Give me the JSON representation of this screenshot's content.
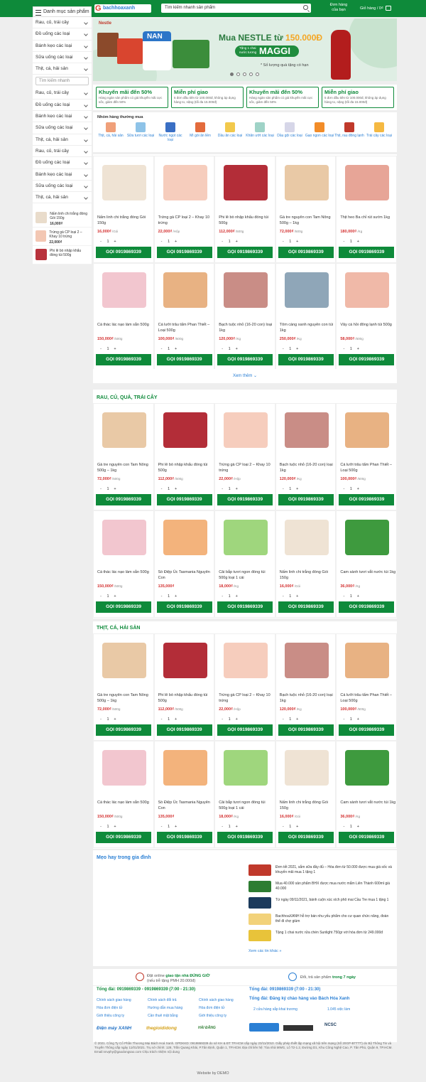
{
  "header": {
    "logo_text": "bachhoaxanh",
    "search_placeholder": "Tìm kiếm nhanh sản phẩm",
    "orders_label": "Đơn hàng của bạn",
    "cart_label": "Giỏ hàng / 0₫"
  },
  "sidebar": {
    "title": "Danh mục sản phẩm",
    "categories_a": [
      "Rau, củ, trái cây",
      "Đồ uống các loại",
      "Bánh kẹo các loại",
      "Sữa uống các loại",
      "Thịt, cá, hải sản"
    ],
    "search_placeholder": "Tìm kiếm nhanh",
    "categories_b": [
      "Rau, củ, trái cây",
      "Đồ uống các loại",
      "Bánh kẹo các loại",
      "Sữa uống các loại",
      "Thịt, cá, hải sản",
      "Rau, củ, trái cây",
      "Đồ uống các loại",
      "Bánh kẹo các loại",
      "Sữa uống các loại",
      "Thịt, cá, hải sản"
    ],
    "mini_products": [
      {
        "name": "Nấm linh chi trắng đóng Gói 150g",
        "price": "16,000₫",
        "color": "#e9dccb"
      },
      {
        "name": "Trứng gà CP loại 2 – Khay 10 trứng",
        "price": "22,000₫",
        "color": "#f3c7b3"
      },
      {
        "name": "Phi lê bò nhập khẩu đóng túi 500g",
        "price": "",
        "color": "#b8323c"
      }
    ]
  },
  "banner": {
    "brand": "Nestle",
    "title_prefix": "Mua NESTLE từ ",
    "title_amount": "150.000Đ",
    "badge_small": "Tặng 1 chai nước tương",
    "badge": "MAGGI",
    "note": "* Số lượng quà tặng có hạn",
    "tin_label": "NAN"
  },
  "promos": [
    {
      "title": "Khuyến mãi đến 50%",
      "desc": "Hàng ngàn sản phẩm có giá khuyến mãi cực sốc, giảm đến 50%"
    },
    {
      "title": "Miễn phí giao",
      "desc": "5 đơn đầu tiên từ 100.000đ, không áp dụng hàng to, nặng (tối đa 15.000đ)"
    },
    {
      "title": "Khuyến mãi đến 50%",
      "desc": "Hàng ngàn sản phẩm có giá khuyến mãi cực sốc, giảm đến 50%"
    },
    {
      "title": "Miễn phí giao",
      "desc": "5 đơn đầu tiên từ 100.000đ, không áp dụng hàng to, nặng (tối đa 15.000đ)"
    }
  ],
  "groups": {
    "title": "Nhóm hàng thường mua",
    "items": [
      {
        "label": "Thịt, cá, hải sản",
        "color": "#f0a07a"
      },
      {
        "label": "Sữa tươi các loại",
        "color": "#8ec3e8"
      },
      {
        "label": "Nước ngọt các loại",
        "color": "#3a6fc4"
      },
      {
        "label": "Mì gói ăn liền",
        "color": "#e36b3c"
      },
      {
        "label": "Dầu ăn các loại",
        "color": "#f2c94c"
      },
      {
        "label": "Khăn ướt các loại",
        "color": "#9fd3c7"
      },
      {
        "label": "Dầu gội các loại",
        "color": "#d6d6e8"
      },
      {
        "label": "Gạo ngon các loại",
        "color": "#f28c28"
      },
      {
        "label": "Thịt, rau đông lạnh",
        "color": "#c0392b"
      },
      {
        "label": "Trái cây các loại",
        "color": "#f5b942"
      }
    ]
  },
  "products_featured": [
    {
      "name": "Nấm linh chi trắng đóng Gói 150g",
      "price": "16,000₫",
      "unit": " /Gói",
      "color": "#efe3d4"
    },
    {
      "name": "Trứng gà CP loại 2 – Khay 10 trứng",
      "price": "22,000₫",
      "unit": " /Hộp",
      "color": "#f6cdbd"
    },
    {
      "name": "Phi lê bò nhập khẩu đóng túi 500g",
      "price": "112,000₫",
      "unit": " /500g",
      "color": "#b32d38"
    },
    {
      "name": "Gà tre nguyên con Tam Nông 500g – 1kg",
      "price": "72,000₫",
      "unit": " /500g",
      "color": "#e9c9a6"
    },
    {
      "name": "Thịt heo Ba chỉ rút sườn 1kg",
      "price": "180,000₫",
      "unit": " /Kg",
      "color": "#e7a597"
    },
    {
      "name": "Cá thác lác nạo làm sẵn 500g",
      "price": "150,000₫",
      "unit": " /500g",
      "color": "#f2c6cf"
    },
    {
      "name": "Cá lưỡi trâu tẩm Phan Thiết – Loại 500g",
      "price": "100,000₫",
      "unit": " /500g",
      "color": "#e8b283"
    },
    {
      "name": "Bạch tuộc nhỏ (16-20 con) loại 1kg",
      "price": "120,000₫",
      "unit": " /Kg",
      "color": "#c98d86"
    },
    {
      "name": "Tôm càng xanh nguyên con túi 1kg",
      "price": "250,000₫",
      "unit": " /Kg",
      "color": "#8fa6b8"
    },
    {
      "name": "Vây cá hồi đông lạnh túi 500g",
      "price": "58,000₫",
      "unit": " /500g",
      "color": "#f0b9a8"
    }
  ],
  "more_label": "Xem thêm ⌄",
  "section1_title": "RAU, CỦ, QUẢ, TRÁI CÂY",
  "section2_title": "THỊT, CÁ, HẢI SẢN",
  "products_section": [
    {
      "name": "Gà tre nguyên con Tam Nông 500g – 1kg",
      "price": "72,000₫",
      "unit": " /500g",
      "color": "#e9c9a6"
    },
    {
      "name": "Phi lê bò nhập khẩu đóng túi 500g",
      "price": "112,000₫",
      "unit": " /500g",
      "color": "#b32d38"
    },
    {
      "name": "Trứng gà CP loại 2 – Khay 10 trứng",
      "price": "22,000₫",
      "unit": " /Hộp",
      "color": "#f6cdbd"
    },
    {
      "name": "Bạch tuộc nhỏ (16-20 con) loại 1kg",
      "price": "120,000₫",
      "unit": " /Kg",
      "color": "#c98d86"
    },
    {
      "name": "Cá lưỡi trâu tẩm Phan Thiết – Loại 500g",
      "price": "100,000₫",
      "unit": " /500g",
      "color": "#e8b283"
    },
    {
      "name": "Cá thác lác nạo làm sẵn 500g",
      "price": "150,000₫",
      "unit": " /500g",
      "color": "#f2c6cf"
    },
    {
      "name": "Sò Điệp Úc Tasmania Nguyên Con",
      "price": "135,000₫",
      "unit": "",
      "color": "#f3b37c"
    },
    {
      "name": "Cải bắp tươi ngon đóng túi 500g loại 1 cái",
      "price": "18,000₫",
      "unit": " /Kg",
      "color": "#9fd67d"
    },
    {
      "name": "Nấm linh chi trắng đóng Gói 150g",
      "price": "16,000₫",
      "unit": " /Gói",
      "color": "#efe3d4"
    },
    {
      "name": "Cam sành tươi vắt nước túi 1kg",
      "price": "36,000₫",
      "unit": " /Kg",
      "color": "#3e9a3e"
    }
  ],
  "call_button": "GỌI 0919869339",
  "qty": {
    "minus": "-",
    "value": "1",
    "plus": "+"
  },
  "tips": {
    "title": "Mẹo hay trong gia đình",
    "items": [
      {
        "text": "Đơn tết 2021, sắm sữa đầy đủ – Hóa đơn từ 50.000 được mua giá sốc và khuyến mãi mua 1 tặng 1",
        "color": "#c0392b"
      },
      {
        "text": "Mua 40.000 sản phẩm BHX được mua nước mắm Liên Thành 600ml giá 40.000",
        "color": "#2e7d32"
      },
      {
        "text": "Từ ngày 09/11/2021, bánh cuộn xúc xích phô mai Cầu Tre mua 1 tặng 1",
        "color": "#1b3a5c"
      },
      {
        "text": "BachhoaXANH hỗ trợ bán nhu yếu phẩm cho cư quan chức năng, đoàn thể đi chợ giùm",
        "color": "#f2d27a"
      },
      {
        "text": "Tặng 1 chai nước rửa chén Sunlight 750gr với hóa đơn từ 249.000đ",
        "color": "#e8c33a"
      }
    ],
    "link": "Xem các tin khác »"
  },
  "footer": {
    "guarantee1_prefix": "Đặt online ",
    "guarantee1_bold": "giao tận nhà ĐÚNG GIỜ",
    "guarantee1_sub": "(nếu trễ tặng PMH 20.000đ)",
    "guarantee2_prefix": "Đổi, trả sản phẩm ",
    "guarantee2_bold": "trong 7 ngày",
    "hotline_left": "Tổng đài: 0919869339 - 0919869339 (7:00 - 21:30)",
    "hotline_right": "Tổng đài: 0919869339 (7:00 - 21:30)",
    "register": "Tổng đài: Đăng ký chào hàng vào Bách Hóa Xanh",
    "links": [
      "Chính sách giao hàng",
      "Chính sách đổi trả",
      "Chính sách giao hàng",
      "Hóa đơn điện tử",
      "Hướng dẫn mua hàng",
      "Hóa đơn điện tử",
      "Giới thiệu công ty",
      "Cần thuê mặt bằng",
      "Giới thiệu công ty"
    ],
    "right_links": [
      "2 cửa hàng sắp khai trương",
      "1.045 việc làm"
    ],
    "logos": [
      "Điện máy XANH",
      "thegioididong",
      "HẢI ĐĂNG"
    ],
    "copyright": "© 2021. Công Ty Cổ Phần Thương Mại Bách Hoá Xanh. GPDKKD: 0919869339 do sở KH & ĐT TP.HCM cấp ngày 23/11/2010. Giấy phép thiết lập mạng xã hội trên mạng (Số 20GP-BTTTT) do Bộ Thông Tin và Truyền Thông cấp ngày 11/01/2021. Trụ sở chính: 128, Trần Quang Khải, P.Tân Định, Quận 1, TP.HCM. Địa chỉ liên hệ: Tòa nhà MWG, Lô T2-1.2, Đường D1, Khu Công Nghệ Cao, P. Tân Phú, Quận 9, TP.HCM. Email:nnvphy@gaodongsao.com Chịu trách nhiệm nội dung",
    "bottom": "Website by DEMO"
  }
}
